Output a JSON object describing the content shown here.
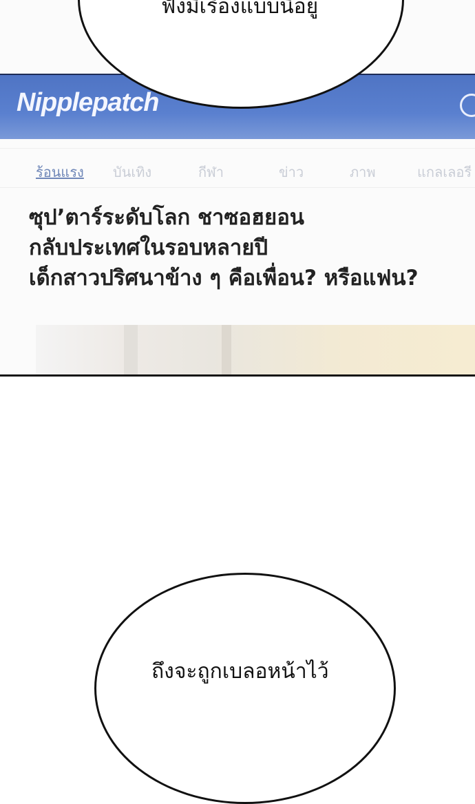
{
  "app": {
    "logo": "Nipplepatch",
    "tabs": [
      "ร้อนแรง",
      "บันเทิง",
      "กีฬา",
      "ข่าว",
      "ภาพ",
      "แกลเลอรี"
    ]
  },
  "article": {
    "headline_lines": [
      "ซุป’ตาร์ระดับโลก ชาซอฮยอน",
      "กลับประเทศในรอบหลายปี",
      "เด็กสาวปริศนาข้าง ๆ คือเพื่อน? หรือแฟน?"
    ]
  },
  "speech": {
    "top_text": "ฟังมีเรื่องแบบนี้อยู่",
    "bottom_text": "ถึงจะถูกเบลอหน้าไว้"
  }
}
